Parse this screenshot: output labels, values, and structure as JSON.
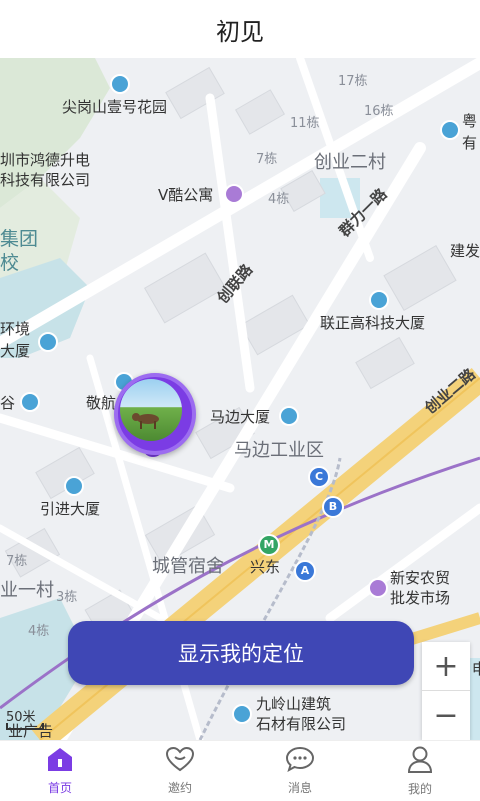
{
  "header": {
    "title": "初见"
  },
  "map": {
    "pois": [
      {
        "name": "尖岗山壹号花园"
      },
      {
        "name": "V酷公寓"
      },
      {
        "name": "联正高科技大厦"
      },
      {
        "name": "马边大厦"
      },
      {
        "name": "引进大厦"
      },
      {
        "name": "敬航"
      },
      {
        "name": "新安农贸\n批发市场"
      },
      {
        "name": "九岭山建筑\n石材有限公司"
      }
    ],
    "company": "圳市鸿德升电\n科技有限公司",
    "districts": [
      "创业二村",
      "马边工业区",
      "城管宿舍",
      "业一村"
    ],
    "roads": [
      "群力一路",
      "创联路",
      "创业二路"
    ],
    "buildings": [
      "17栋",
      "16栋",
      "11栋",
      "7栋",
      "4栋",
      "7栋",
      "3栋",
      "4栋"
    ],
    "edge_labels": [
      "集团",
      "校",
      "环境",
      "大厦",
      "谷",
      "粤",
      "有",
      "建发",
      "业广告",
      "申"
    ],
    "station": "兴东",
    "metro_marks": [
      "C",
      "B",
      "A"
    ],
    "scale": "50米"
  },
  "locate_button": {
    "label": "显示我的定位"
  },
  "zoom": {
    "in": "+",
    "out": "−"
  },
  "tabs": [
    {
      "label": "首页",
      "active": true,
      "icon": "home-icon"
    },
    {
      "label": "邀约",
      "active": false,
      "icon": "heart-icon"
    },
    {
      "label": "消息",
      "active": false,
      "icon": "chat-icon"
    },
    {
      "label": "我的",
      "active": false,
      "icon": "user-icon"
    }
  ],
  "colors": {
    "accent": "#7b3ce4",
    "button": "#3f47b5",
    "main_road": "#f4d27a"
  }
}
